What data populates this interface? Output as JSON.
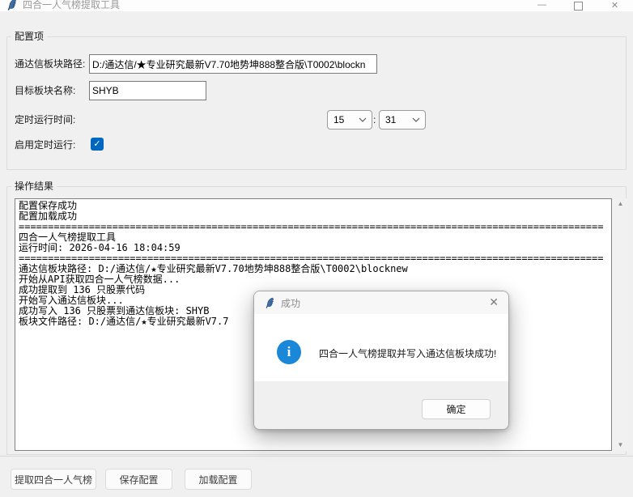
{
  "window": {
    "title": "四合一人气榜提取工具"
  },
  "icons": {
    "minimize": "—",
    "close": "✕",
    "dialog_close": "✕",
    "check": "✓",
    "info": "i",
    "scroll_up": "▲",
    "scroll_down": "▼"
  },
  "config_group": {
    "title": "配置项",
    "path_label": "通达信板块路径:",
    "path_value": "D:/通达信/★专业研究最新V7.70地势坤888整合版\\T0002\\blockn",
    "name_label": "目标板块名称:",
    "name_value": "SHYB",
    "time_label": "定时运行时间:",
    "hour_value": "15",
    "time_separator": ":",
    "minute_value": "31",
    "enable_label": "启用定时运行:",
    "enable_checked": true
  },
  "result_group": {
    "title": "操作结果",
    "log_lines": [
      "配置保存成功",
      "配置加载成功",
      "====================================================================================================",
      "四合一人气榜提取工具",
      "运行时间: 2026-04-16 18:04:59",
      "====================================================================================================",
      "通达信板块路径: D:/通达信/★专业研究最新V7.70地势坤888整合版\\T0002\\blocknew",
      "开始从API获取四合一人气榜数据...",
      "成功提取到 136 只股票代码",
      "开始写入通达信板块...",
      "成功写入 136 只股票到通达信板块: SHYB",
      "板块文件路径: D:/通达信/★专业研究最新V7.7"
    ]
  },
  "actions": {
    "extract_label": "提取四合一人气榜",
    "save_label": "保存配置",
    "load_label": "加载配置"
  },
  "dialog": {
    "title": "成功",
    "message": "四合一人气榜提取并写入通达信板块成功!",
    "ok_label": "确定"
  },
  "colors": {
    "window_bg": "#f0f0f0",
    "accent_checkbox": "#0067c0",
    "info_icon_blue": "#1b87d9",
    "titlebar_bg": "#fdfdfd"
  }
}
